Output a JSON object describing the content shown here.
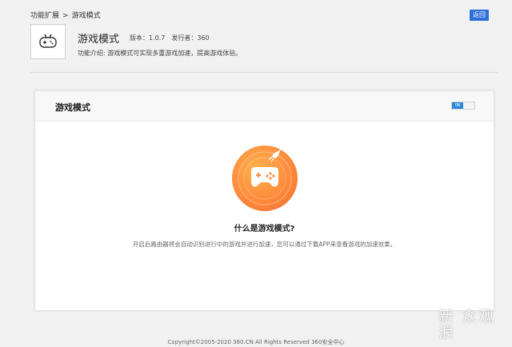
{
  "breadcrumb": {
    "parent": "功能扩展",
    "separator": ">",
    "current": "游戏模式"
  },
  "back_button": "返回",
  "app": {
    "icon": "gamepad-icon",
    "title": "游戏模式",
    "version": "版本：1.0.7",
    "publisher": "发行者：360",
    "description": "功能介绍: 游戏模式可实现多重游戏加速，提高游戏体验。"
  },
  "card": {
    "title": "游戏模式",
    "toggle_label": "ON",
    "toggle_state": "on",
    "illustration_icon": "gamepad-rocket-icon",
    "question": "什么是游戏模式?",
    "explanation": "开启后路由器将会自动识别进行中的游戏并进行加速，您可以通过下载APP来查看游戏的加速效果。"
  },
  "footer": "Copyright©2005-2020 360.CN All Rights Reserved 360安全中心",
  "watermark": "新 众观\n浪",
  "colors": {
    "accent": "#2d6ed8",
    "toggle_on": "#2a86d8",
    "illustration": "#ff8a3c"
  }
}
